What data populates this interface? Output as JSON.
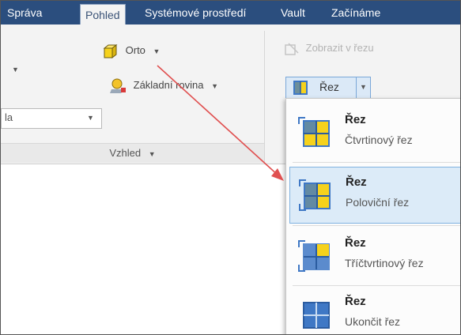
{
  "tabs": [
    {
      "label": "Správa",
      "active": false
    },
    {
      "label": "Pohled",
      "active": true
    },
    {
      "label": "Systémové prostředí",
      "active": false
    },
    {
      "label": "Vault",
      "active": false
    },
    {
      "label": "Začínáme",
      "active": false
    }
  ],
  "ribbon": {
    "orto_label": "Orto",
    "zakladni_rovina_label": "Základní rovina",
    "zobrazit_v_rezu_label": "Zobrazit v řezu",
    "rez_button_label": "Řez",
    "combo_value_partial": "la",
    "group_label": "Vzhled"
  },
  "menu": {
    "items": [
      {
        "title": "Řez",
        "subtitle": "Čtvrtinový řez",
        "icon": "quarter-section-icon",
        "highlighted": false
      },
      {
        "title": "Řez",
        "subtitle": "Poloviční řez",
        "icon": "half-section-icon",
        "highlighted": true
      },
      {
        "title": "Řez",
        "subtitle": "Tříčtvrtinový řez",
        "icon": "three-quarter-section-icon",
        "highlighted": false
      },
      {
        "title": "Řez",
        "subtitle": "Ukončit řez",
        "icon": "end-section-icon",
        "highlighted": false
      }
    ]
  },
  "colors": {
    "tabbar": "#2b4e7e",
    "highlight": "#dcebf8",
    "annotation_arrow": "#e05050",
    "icon_yellow": "#f6d21c",
    "icon_blue": "#3f78c5"
  }
}
